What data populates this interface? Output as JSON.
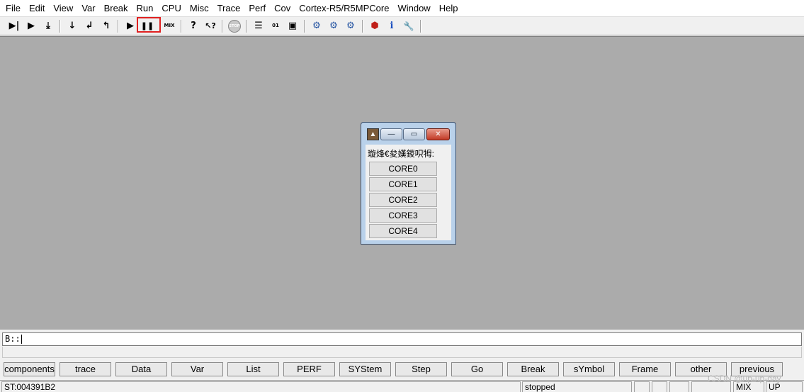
{
  "menubar": {
    "items": [
      "File",
      "Edit",
      "View",
      "Var",
      "Break",
      "Run",
      "CPU",
      "Misc",
      "Trace",
      "Perf",
      "Cov",
      "Cortex-R5/R5MPCore",
      "Window",
      "Help"
    ]
  },
  "toolbar": {
    "icons": [
      {
        "name": "step-into-icon",
        "glyph": "▶|"
      },
      {
        "name": "step-over-icon",
        "glyph": "▶"
      },
      {
        "name": "step-out-icon",
        "glyph": "⤓"
      },
      {
        "name": "go-down-icon",
        "glyph": "↓"
      },
      {
        "name": "return-icon",
        "glyph": "↲"
      },
      {
        "name": "go-up-icon",
        "glyph": "↰"
      },
      {
        "name": "go-icon",
        "glyph": "▶"
      },
      {
        "name": "break-icon",
        "glyph": "❚❚"
      },
      {
        "name": "source-mode-icon",
        "glyph": "MIX"
      },
      {
        "name": "help-icon",
        "glyph": "?"
      },
      {
        "name": "context-help-icon",
        "glyph": "↖?"
      },
      {
        "name": "stop-icon",
        "glyph": "STOP"
      },
      {
        "name": "list-icon",
        "glyph": "☰"
      },
      {
        "name": "dump-icon",
        "glyph": "01"
      },
      {
        "name": "register-icon",
        "glyph": "▣"
      },
      {
        "name": "trace-icon",
        "glyph": "⚙"
      },
      {
        "name": "trace-chart-icon",
        "glyph": "⚙"
      },
      {
        "name": "trace-list-icon",
        "glyph": "⚙"
      },
      {
        "name": "target-icon",
        "glyph": "⬢"
      },
      {
        "name": "info-icon",
        "glyph": "i"
      },
      {
        "name": "settings-icon",
        "glyph": "🔧"
      }
    ]
  },
  "dialog": {
    "label": "璇烽€夋嫨鍐呮牳:",
    "minimize_glyph": "—",
    "maximize_glyph": "▭",
    "close_glyph": "✕",
    "buttons": [
      "CORE0",
      "CORE1",
      "CORE2",
      "CORE3",
      "CORE4"
    ]
  },
  "commandline": {
    "prompt": "B::"
  },
  "softkeys": [
    "components",
    "trace",
    "Data",
    "Var",
    "List",
    "PERF",
    "SYStem",
    "Step",
    "Go",
    "Break",
    "sYmbol",
    "Frame",
    "other",
    "previous"
  ],
  "statusbar": {
    "address": "ST:004391B2",
    "state": "stopped",
    "mode": "MIX",
    "direction": "UP"
  },
  "watermark": "CSDN @up-up-day",
  "colors": {
    "workspace": "#ababab",
    "highlight_box": "#e02020",
    "dialog_frame": "#b9d1ea"
  }
}
